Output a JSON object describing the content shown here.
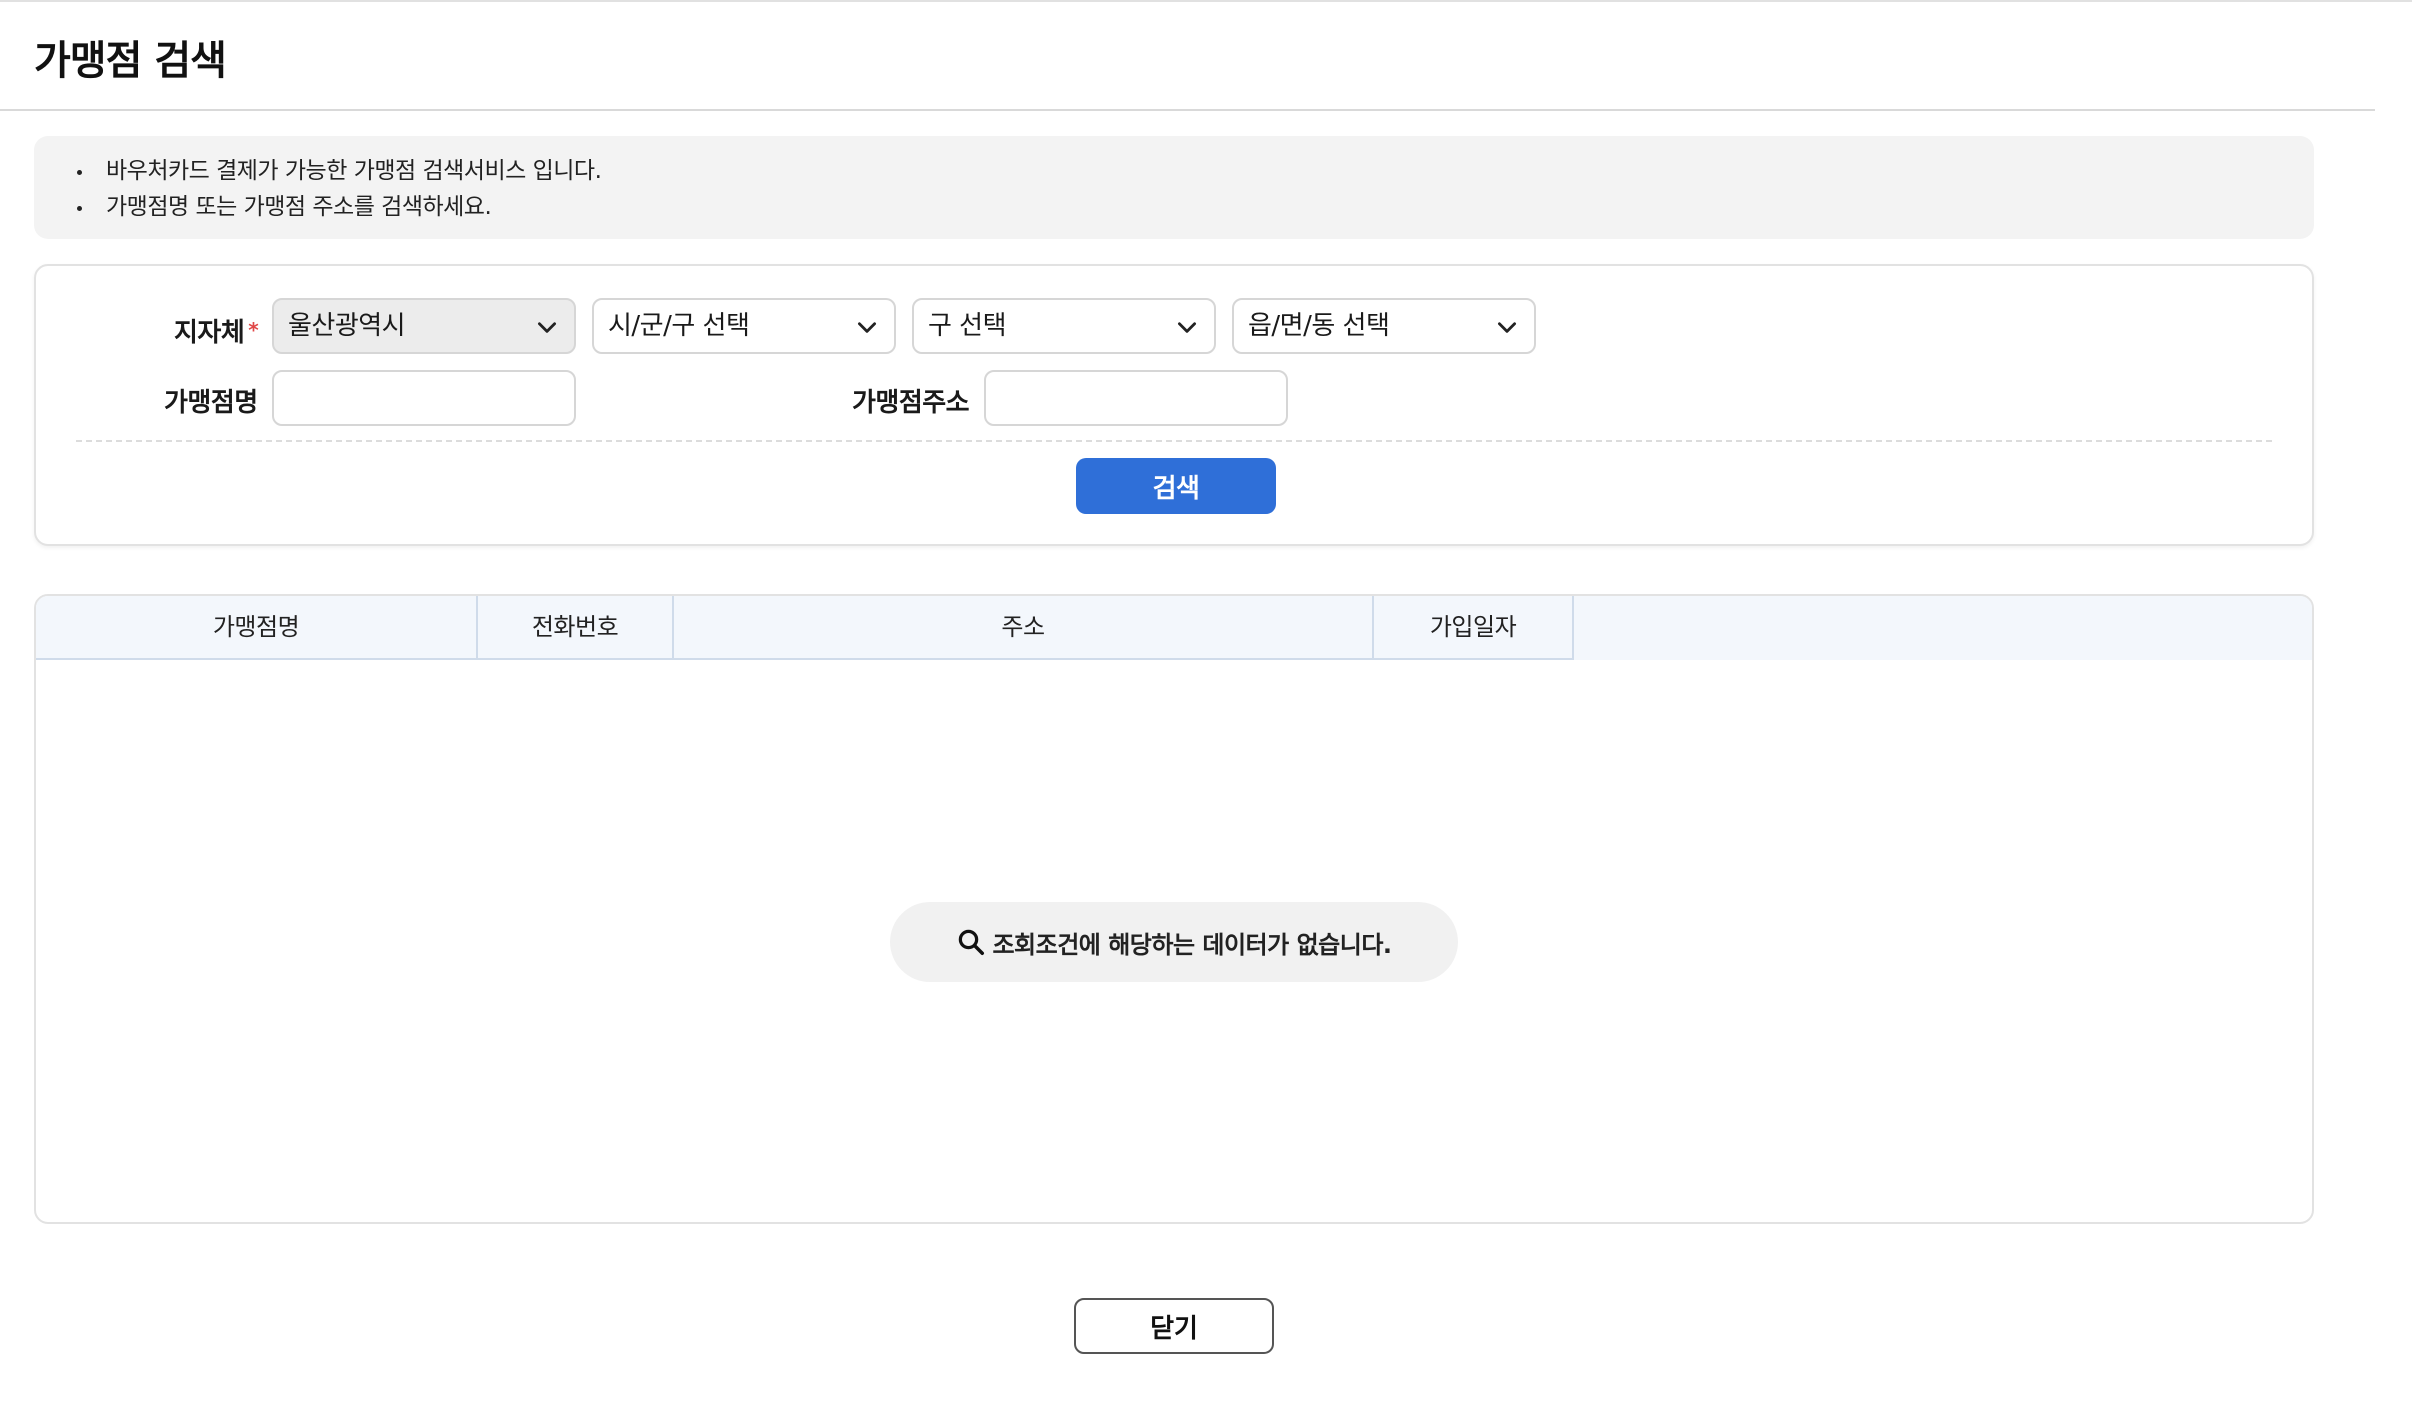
{
  "page": {
    "title": "가맹점 검색"
  },
  "notice": {
    "items": [
      "바우처카드 결제가 가능한 가맹점 검색서비스 입니다.",
      "가맹점명 또는 가맹점 주소를 검색하세요."
    ]
  },
  "search": {
    "region_label": "지자체",
    "required_mark": "*",
    "selects": [
      {
        "value": "울산광역시",
        "disabled": true
      },
      {
        "value": "시/군/구 선택"
      },
      {
        "value": "구 선택"
      },
      {
        "value": "읍/면/동 선택"
      }
    ],
    "store_name_label": "가맹점명",
    "store_name_value": "",
    "store_address_label": "가맹점주소",
    "store_address_value": "",
    "search_button": "검색",
    "accent_color": "#2f6fd8"
  },
  "table": {
    "columns": [
      "가맹점명",
      "전화번호",
      "주소",
      "가입일자"
    ],
    "rows": [],
    "empty_message": "조회조건에 해당하는 데이터가 없습니다.",
    "empty_icon": "search-icon"
  },
  "footer": {
    "close_button": "닫기"
  }
}
